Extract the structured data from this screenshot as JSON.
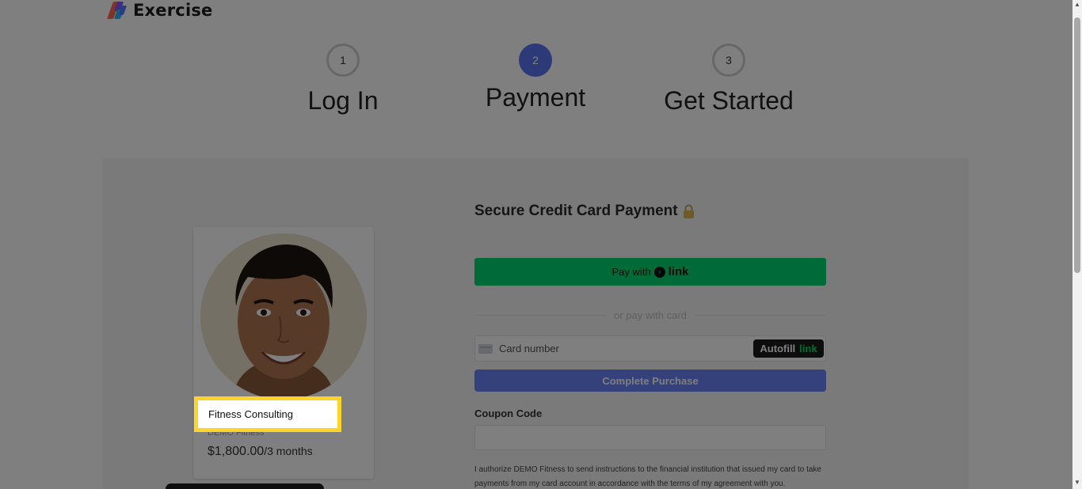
{
  "brand": {
    "title": "Exercise"
  },
  "steps": [
    {
      "number": "1",
      "label": "Log In",
      "state": "idle"
    },
    {
      "number": "2",
      "label": "Payment",
      "state": "active"
    },
    {
      "number": "3",
      "label": "Get Started",
      "state": "idle"
    }
  ],
  "product": {
    "name": "Fitness Consulting",
    "subtitle": "DEMO Fitness",
    "price": "$1,800.00",
    "period": "/3 months"
  },
  "payment": {
    "title": "Secure Credit Card Payment",
    "link_button": {
      "prefix": "Pay with",
      "brand": "link"
    },
    "divider_text": "or pay with card",
    "card_number_placeholder": "Card number",
    "autofill": {
      "label": "Autofill",
      "brand": "link"
    },
    "complete_label": "Complete Purchase",
    "coupon_label": "Coupon Code",
    "coupon_value": "",
    "authorization_text": "I authorize DEMO Fitness to send instructions to the financial institution that issued my card to take payments from my card account in accordance with the terms of my agreement with you."
  },
  "colors": {
    "accent": "#5a75f0",
    "link_green": "#00d66f",
    "highlight": "#ffd42a"
  },
  "icons": {
    "lock": "lock-icon",
    "card": "credit-card-icon",
    "logo": "brand-logo-icon"
  }
}
